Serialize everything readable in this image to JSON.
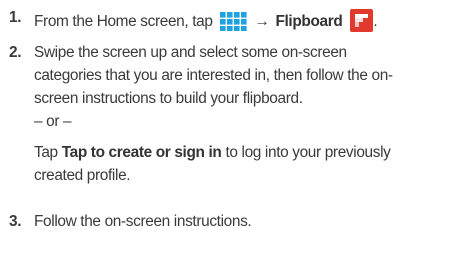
{
  "icons": {
    "apps_grid": "apps-grid-icon",
    "flipboard": "flipboard-icon",
    "apps_grid_color": "#1fa2e0",
    "flipboard_color": "#e1392e"
  },
  "steps": [
    {
      "number": "1.",
      "intro": "From the Home screen, tap",
      "arrow": "→",
      "app_name": "Flipboard",
      "end": "."
    },
    {
      "number": "2.",
      "lines": [
        "Swipe the screen up and select some on-screen",
        "categories that you are interested in, then follow the on-",
        "screen instructions to build your flipboard."
      ],
      "or": "– or –",
      "alt_prefix": "Tap",
      "alt_bold": "Tap to create or sign in",
      "alt_suffix": "to log into your previously",
      "alt_line2": "created profile."
    },
    {
      "number": "3.",
      "text": "Follow the on-screen instructions."
    }
  ]
}
